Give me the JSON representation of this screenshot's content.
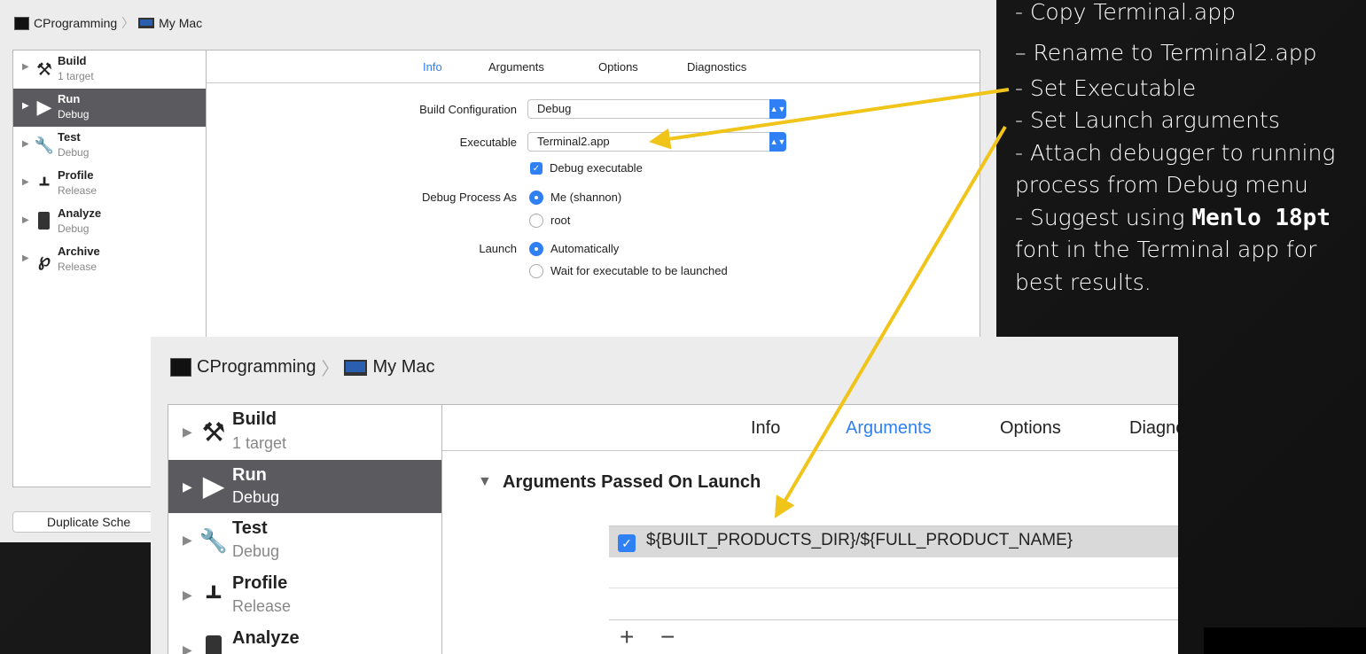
{
  "breadcrumb": {
    "project": "CProgramming",
    "destination": "My Mac"
  },
  "actions": [
    {
      "name": "Build",
      "sub": "1 target",
      "icon": "hammer-icon"
    },
    {
      "name": "Run",
      "sub": "Debug",
      "icon": "play-icon"
    },
    {
      "name": "Test",
      "sub": "Debug",
      "icon": "wrench-icon"
    },
    {
      "name": "Profile",
      "sub": "Release",
      "icon": "instruments-icon"
    },
    {
      "name": "Analyze",
      "sub": "Debug",
      "icon": "analyze-icon"
    },
    {
      "name": "Archive",
      "sub": "Release",
      "icon": "archive-icon"
    }
  ],
  "tabs": [
    "Info",
    "Arguments",
    "Options",
    "Diagnostics"
  ],
  "tabs_clipped": "Diagno",
  "info": {
    "build_config_label": "Build Configuration",
    "build_config_value": "Debug",
    "executable_label": "Executable",
    "executable_value": "Terminal2.app",
    "debug_executable": "Debug executable",
    "debug_as_label": "Debug Process As",
    "debug_as_options": [
      "Me (shannon)",
      "root"
    ],
    "launch_label": "Launch",
    "launch_options": [
      "Automatically",
      "Wait for executable to be launched"
    ]
  },
  "duplicate_button": "Duplicate Sche",
  "arguments": {
    "section_title": "Arguments Passed On Launch",
    "items": [
      "${BUILT_PRODUCTS_DIR}/${FULL_PRODUCT_NAME}"
    ],
    "add": "+",
    "remove": "−"
  },
  "notes": {
    "l1": "- Copy Terminal.app",
    "l2": "–  Rename to Terminal2.app",
    "l3": "- Set Executable",
    "l4": "- Set Launch arguments",
    "l5": "- Attach debugger to running",
    "l6": "process from Debug menu",
    "l7a": "- Suggest using ",
    "l7b": "Menlo 18pt",
    "l8": "font in the Terminal app for",
    "l9": "best results."
  },
  "colors": {
    "accent": "#2f7ff5",
    "arrow": "#f0c419",
    "selected_row": "#5b5b5f"
  }
}
